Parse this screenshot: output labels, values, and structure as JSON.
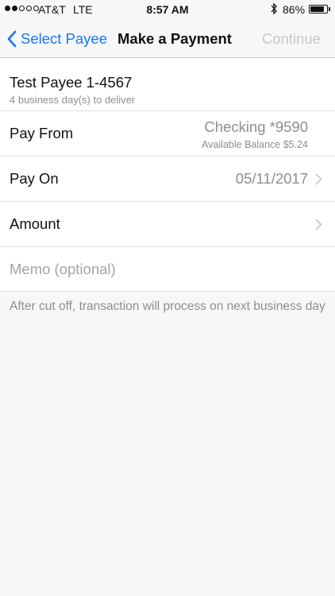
{
  "status_bar": {
    "carrier": "AT&T",
    "network": "LTE",
    "time": "8:57 AM",
    "battery_percent": "86%",
    "battery_level": 0.86,
    "signal_bars_filled": 2,
    "signal_bars_total": 5
  },
  "nav": {
    "back_label": "Select Payee",
    "title": "Make a Payment",
    "continue_label": "Continue"
  },
  "payee": {
    "name": "Test Payee 1-4567",
    "delivery_note": "4 business day(s) to deliver"
  },
  "pay_from": {
    "label": "Pay From",
    "account": "Checking *9590",
    "balance": "Available Balance $5.24"
  },
  "pay_on": {
    "label": "Pay On",
    "date": "05/11/2017"
  },
  "amount": {
    "label": "Amount",
    "value": ""
  },
  "memo": {
    "placeholder": "Memo (optional)",
    "value": ""
  },
  "footnote": "After cut off, transaction will process on next business day",
  "colors": {
    "accent": "#1478f5",
    "disabled": "#c7c7cc",
    "secondary_text": "#8e8e93",
    "background": "#f7f7f7"
  }
}
